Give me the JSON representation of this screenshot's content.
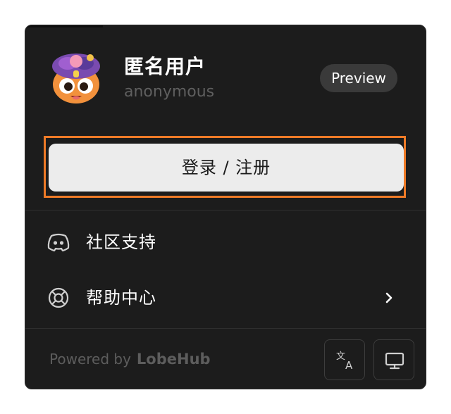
{
  "user": {
    "name": "匿名用户",
    "handle": "anonymous",
    "badge": "Preview",
    "avatar_icon": "cartoon-face-avatar-icon"
  },
  "actions": {
    "login_label": "登录 / 注册"
  },
  "menu": {
    "items": [
      {
        "label": "社区支持",
        "icon": "discord-icon",
        "has_chevron": false
      },
      {
        "label": "帮助中心",
        "icon": "lifebuoy-icon",
        "has_chevron": true
      }
    ]
  },
  "footer": {
    "powered_by": "Powered by",
    "brand": "LobeHub",
    "buttons": [
      {
        "icon": "translate-icon"
      },
      {
        "icon": "monitor-icon"
      }
    ]
  },
  "colors": {
    "panel_bg": "#1c1c1c",
    "highlight": "#ee7a27",
    "button_bg": "#ececec",
    "badge_bg": "#3a3a3a"
  }
}
